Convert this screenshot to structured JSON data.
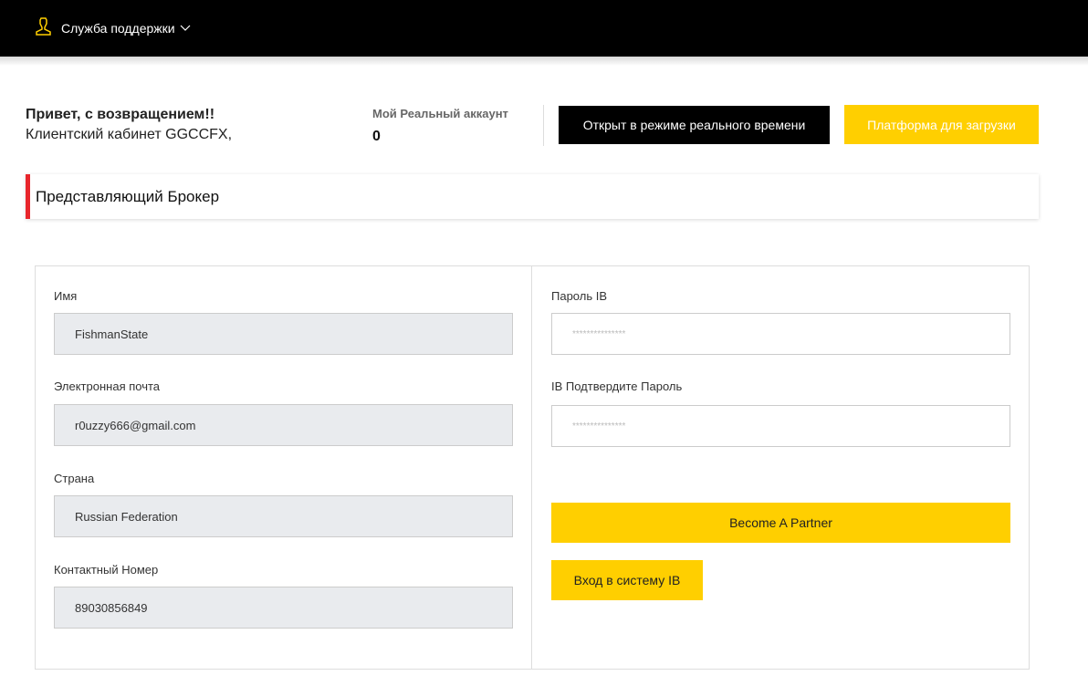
{
  "header": {
    "support_label": "Служба поддержки",
    "support_icon": "user-icon",
    "chevron_icon": "chevron-down-icon"
  },
  "greeting": {
    "title": "Привет, с возвращением!!",
    "subtitle": "Клиентский кабинет GGCCFX,"
  },
  "account": {
    "title": "Мой Реальный аккаунт",
    "value": "0"
  },
  "buttons": {
    "live": "Открыт в режиме реального времени",
    "download": "Платформа для загрузки"
  },
  "section_title": "Представляющий Брокер",
  "form_left": [
    {
      "label": "Имя",
      "value": "FishmanState"
    },
    {
      "label": "Электронная почта",
      "value": "r0uzzy666@gmail.com"
    },
    {
      "label": "Страна",
      "value": "Russian Federation"
    },
    {
      "label": "Контактный Номер",
      "value": "89030856849"
    }
  ],
  "form_right": {
    "password_label": "Пароль IB",
    "password_placeholder": "***************",
    "confirm_label": "IB Подтвердите Пароль",
    "confirm_placeholder": "***************",
    "become_partner": "Become A Partner",
    "ib_login": "Вход в систему IB"
  },
  "colors": {
    "accent": "#ffcf00",
    "section_marker": "#e8262c"
  }
}
